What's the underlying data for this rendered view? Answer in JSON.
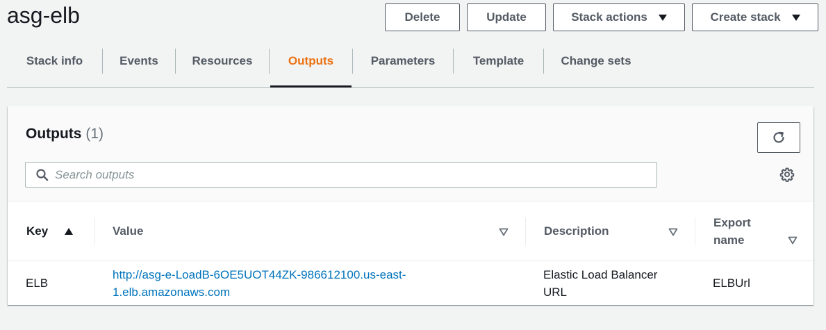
{
  "header": {
    "title": "asg-elb",
    "delete_label": "Delete",
    "update_label": "Update",
    "stack_actions_label": "Stack actions",
    "create_stack_label": "Create stack"
  },
  "tabs": [
    {
      "label": "Stack info"
    },
    {
      "label": "Events"
    },
    {
      "label": "Resources"
    },
    {
      "label": "Outputs",
      "active": true
    },
    {
      "label": "Parameters"
    },
    {
      "label": "Template"
    },
    {
      "label": "Change sets"
    }
  ],
  "outputs": {
    "title": "Outputs",
    "count": "(1)",
    "search_placeholder": "Search outputs",
    "columns": {
      "key": "Key",
      "value": "Value",
      "description": "Description",
      "export_line1": "Export",
      "export_line2": "name"
    },
    "rows": [
      {
        "key": "ELB",
        "value_line1": "http://asg-e-LoadB-6OE5UOT44ZK-986612100.us-east-",
        "value_line2": "1.elb.amazonaws.com",
        "description_line1": "Elastic Load Balancer",
        "description_line2": "URL",
        "export_name": "ELBUrl"
      }
    ]
  },
  "colors": {
    "accent_active_tab": "#ec7211",
    "link": "#0073bb",
    "text": "#16191f",
    "muted": "#545b64"
  },
  "icons": {
    "refresh": "refresh-icon",
    "search": "search-icon",
    "settings": "gear-icon",
    "sort_ascending": "sort-ascending-icon",
    "sort_unsorted": "sort-down-icon",
    "dropdown": "caret-down-icon"
  }
}
